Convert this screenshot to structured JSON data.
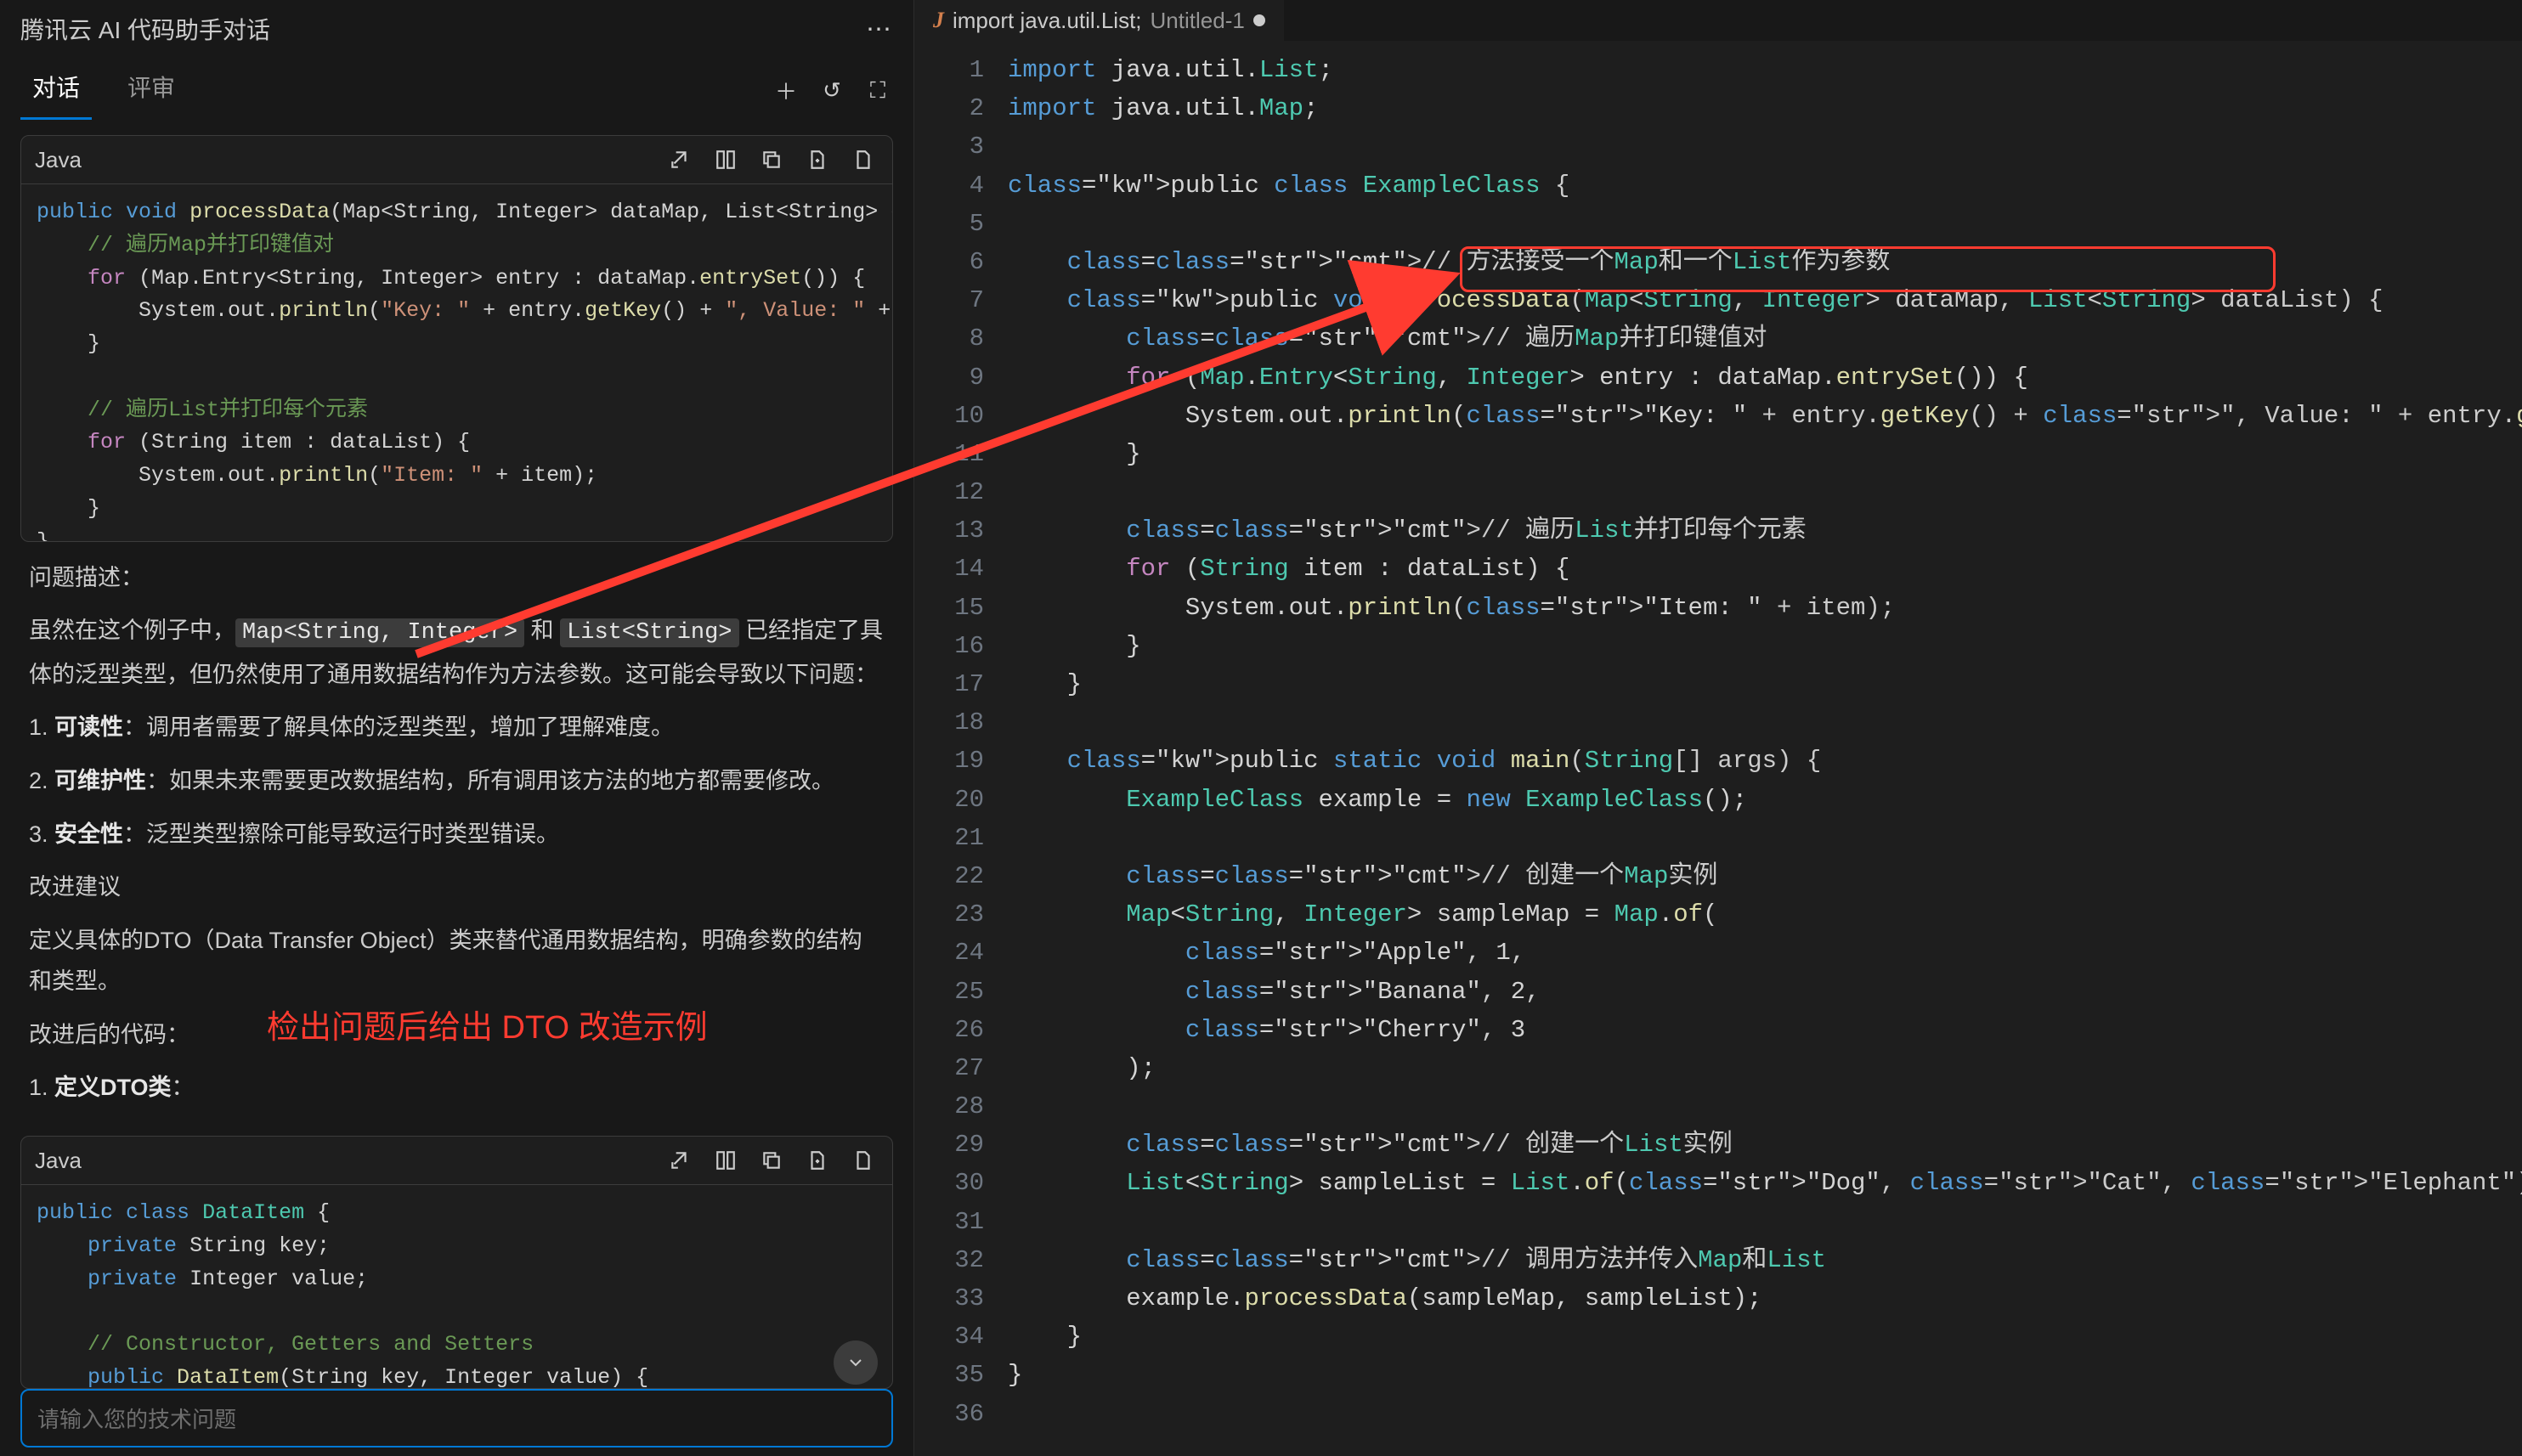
{
  "panel_title": "腾讯云 AI 代码助手对话",
  "tabs": {
    "chat": "对话",
    "review": "评审"
  },
  "code_block1": {
    "lang": "Java",
    "lines": [
      {
        "t": "public void processData(Map<String, Integer> dataMap, List<String> d"
      },
      {
        "t": "    // 遍历Map并打印键值对"
      },
      {
        "t": "    for (Map.Entry<String, Integer> entry : dataMap.entrySet()) {"
      },
      {
        "t": "        System.out.println(\"Key: \" + entry.getKey() + \", Value: \" +"
      },
      {
        "t": "    }"
      },
      {
        "t": ""
      },
      {
        "t": "    // 遍历List并打印每个元素"
      },
      {
        "t": "    for (String item : dataList) {"
      },
      {
        "t": "        System.out.println(\"Item: \" + item);"
      },
      {
        "t": "    }"
      },
      {
        "t": "}"
      }
    ]
  },
  "desc_heading": "问题描述：",
  "desc_intro_a": "虽然在这个例子中，",
  "desc_intro_mid": " 和 ",
  "desc_code1": "Map<String, Integer>",
  "desc_code2": "List<String>",
  "desc_intro_b": " 已经指定了具体的泛型类型，但仍然使用了通用数据结构作为方法参数。这可能会导致以下问题：",
  "issue1_pre": "1. ",
  "issue1_b": "可读性",
  "issue1_t": "：调用者需要了解具体的泛型类型，增加了理解难度。",
  "issue2_pre": "2. ",
  "issue2_b": "可维护性",
  "issue2_t": "：如果未来需要更改数据结构，所有调用该方法的地方都需要修改。",
  "issue3_pre": "3. ",
  "issue3_b": "安全性",
  "issue3_t": "：泛型类型擦除可能导致运行时类型错误。",
  "improve_heading": "改进建议",
  "improve_body": "定义具体的DTO（Data Transfer Object）类来替代通用数据结构，明确参数的结构和类型。",
  "after_heading": "改进后的代码：",
  "step1_pre": "1. ",
  "step1_b": "定义DTO类",
  "step1_t": "：",
  "red_annotation": "检出问题后给出 DTO 改造示例",
  "code_block2": {
    "lang": "Java"
  },
  "input_placeholder": "请输入您的技术问题",
  "editor": {
    "tab_prefix": "import java.util.List;",
    "tab_name": "Untitled-1",
    "lines": [
      "import java.util.List;",
      "import java.util.Map;",
      "",
      "public class ExampleClass {",
      "",
      "    // 方法接受一个Map和一个List作为参数",
      "    public void processData(Map<String, Integer> dataMap, List<String> dataList) {",
      "        // 遍历Map并打印键值对",
      "        for (Map.Entry<String, Integer> entry : dataMap.entrySet()) {",
      "            System.out.println(\"Key: \" + entry.getKey() + \", Value: \" + entry.getValue());",
      "        }",
      "",
      "        // 遍历List并打印每个元素",
      "        for (String item : dataList) {",
      "            System.out.println(\"Item: \" + item);",
      "        }",
      "    }",
      "",
      "    public static void main(String[] args) {",
      "        ExampleClass example = new ExampleClass();",
      "",
      "        // 创建一个Map实例",
      "        Map<String, Integer> sampleMap = Map.of(",
      "            \"Apple\", 1,",
      "            \"Banana\", 2,",
      "            \"Cherry\", 3",
      "        );",
      "",
      "        // 创建一个List实例",
      "        List<String> sampleList = List.of(\"Dog\", \"Cat\", \"Elephant\");",
      "",
      "        // 调用方法并传入Map和List",
      "        example.processData(sampleMap, sampleList);",
      "    }",
      "}",
      ""
    ]
  }
}
